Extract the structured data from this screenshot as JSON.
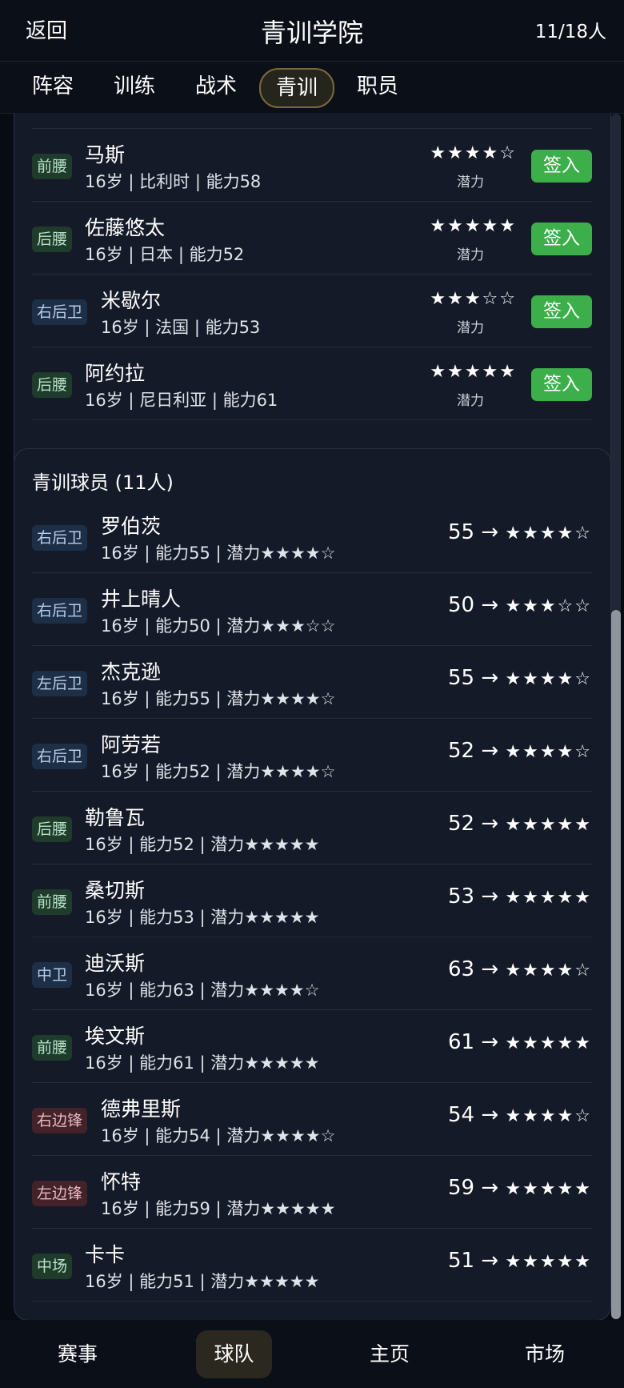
{
  "header": {
    "back_label": "返回",
    "title": "青训学院",
    "count": "11/18人"
  },
  "tabs": [
    {
      "label": "阵容"
    },
    {
      "label": "训练"
    },
    {
      "label": "战术"
    },
    {
      "label": "青训",
      "active": true
    },
    {
      "label": "职员"
    }
  ],
  "prospects": {
    "sign_label": "签入",
    "potential_label": "潜力",
    "items": [
      {
        "position": "前腰",
        "name": "马斯",
        "info": "16岁 | 比利时 | 能力58",
        "stars": "★★★★☆"
      },
      {
        "position": "后腰",
        "name": "佐藤悠太",
        "info": "16岁 | 日本 | 能力52",
        "stars": "★★★★★"
      },
      {
        "position": "右后卫",
        "name": "米歇尔",
        "info": "16岁 | 法国 | 能力53",
        "stars": "★★★☆☆"
      },
      {
        "position": "后腰",
        "name": "阿约拉",
        "info": "16岁 | 尼日利亚 | 能力61",
        "stars": "★★★★★"
      }
    ]
  },
  "youth": {
    "title": "青训球员 (11人)",
    "arrow": "→",
    "players": [
      {
        "position": "右后卫",
        "name": "罗伯茨",
        "info": "16岁 | 能力55 | 潜力★★★★☆",
        "ability": "55",
        "stars": "★★★★☆"
      },
      {
        "position": "右后卫",
        "name": "井上晴人",
        "info": "16岁 | 能力50 | 潜力★★★☆☆",
        "ability": "50",
        "stars": "★★★☆☆"
      },
      {
        "position": "左后卫",
        "name": "杰克逊",
        "info": "16岁 | 能力55 | 潜力★★★★☆",
        "ability": "55",
        "stars": "★★★★☆"
      },
      {
        "position": "右后卫",
        "name": "阿劳若",
        "info": "16岁 | 能力52 | 潜力★★★★☆",
        "ability": "52",
        "stars": "★★★★☆"
      },
      {
        "position": "后腰",
        "name": "勒鲁瓦",
        "info": "16岁 | 能力52 | 潜力★★★★★",
        "ability": "52",
        "stars": "★★★★★"
      },
      {
        "position": "前腰",
        "name": "桑切斯",
        "info": "16岁 | 能力53 | 潜力★★★★★",
        "ability": "53",
        "stars": "★★★★★"
      },
      {
        "position": "中卫",
        "name": "迪沃斯",
        "info": "16岁 | 能力63 | 潜力★★★★☆",
        "ability": "63",
        "stars": "★★★★☆"
      },
      {
        "position": "前腰",
        "name": "埃文斯",
        "info": "16岁 | 能力61 | 潜力★★★★★",
        "ability": "61",
        "stars": "★★★★★"
      },
      {
        "position": "右边锋",
        "name": "德弗里斯",
        "info": "16岁 | 能力54 | 潜力★★★★☆",
        "ability": "54",
        "stars": "★★★★☆"
      },
      {
        "position": "左边锋",
        "name": "怀特",
        "info": "16岁 | 能力59 | 潜力★★★★★",
        "ability": "59",
        "stars": "★★★★★"
      },
      {
        "position": "中场",
        "name": "卡卡",
        "info": "16岁 | 能力51 | 潜力★★★★★",
        "ability": "51",
        "stars": "★★★★★"
      }
    ]
  },
  "bottom_nav": [
    {
      "label": "赛事"
    },
    {
      "label": "球队",
      "active": true
    },
    {
      "label": "主页"
    },
    {
      "label": "市场"
    }
  ],
  "colors": {
    "sign_button": "#3cae4a",
    "background": "#070b13",
    "card": "#141a27",
    "midfield_badge": "#1e3b2c",
    "defense_badge": "#1d2f47",
    "forward_badge": "#43222a"
  }
}
